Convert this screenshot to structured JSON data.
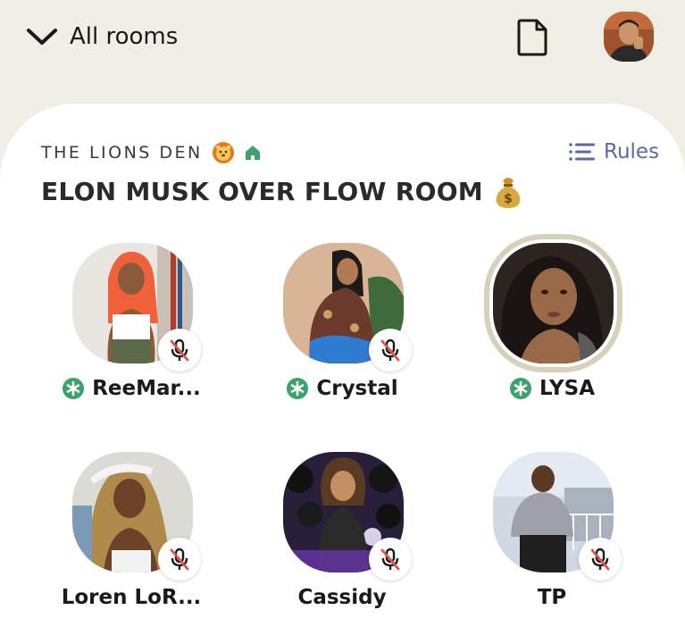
{
  "header": {
    "back_label": "All rooms",
    "icons": {
      "back": "chevron-down-icon",
      "doc": "document-icon",
      "profile": "avatar"
    }
  },
  "room": {
    "club_name": "THE LIONS DEN",
    "club_emoji": "lion-emoji",
    "club_icon": "house-icon",
    "rules_label": "Rules",
    "title": "ELON MUSK OVER FLOW ROOM",
    "title_emoji": "money-bag-emoji"
  },
  "speakers": [
    {
      "name": "ReeMar...",
      "moderator": true,
      "muted": true,
      "speaking": false
    },
    {
      "name": "Crystal",
      "moderator": true,
      "muted": true,
      "speaking": false
    },
    {
      "name": "LYSA",
      "moderator": true,
      "muted": false,
      "speaking": true
    },
    {
      "name": "Loren LoR...",
      "moderator": false,
      "muted": true,
      "speaking": false
    },
    {
      "name": "Cassidy",
      "moderator": false,
      "muted": true,
      "speaking": false
    },
    {
      "name": "TP",
      "moderator": false,
      "muted": true,
      "speaking": false
    }
  ],
  "colors": {
    "background": "#f1efe5",
    "card": "#ffffff",
    "accent_blue": "#5b6aa3",
    "moderator_green": "#3aa26a",
    "mute_red": "#d9534f",
    "speaking_ring": "#d7d1bc"
  }
}
